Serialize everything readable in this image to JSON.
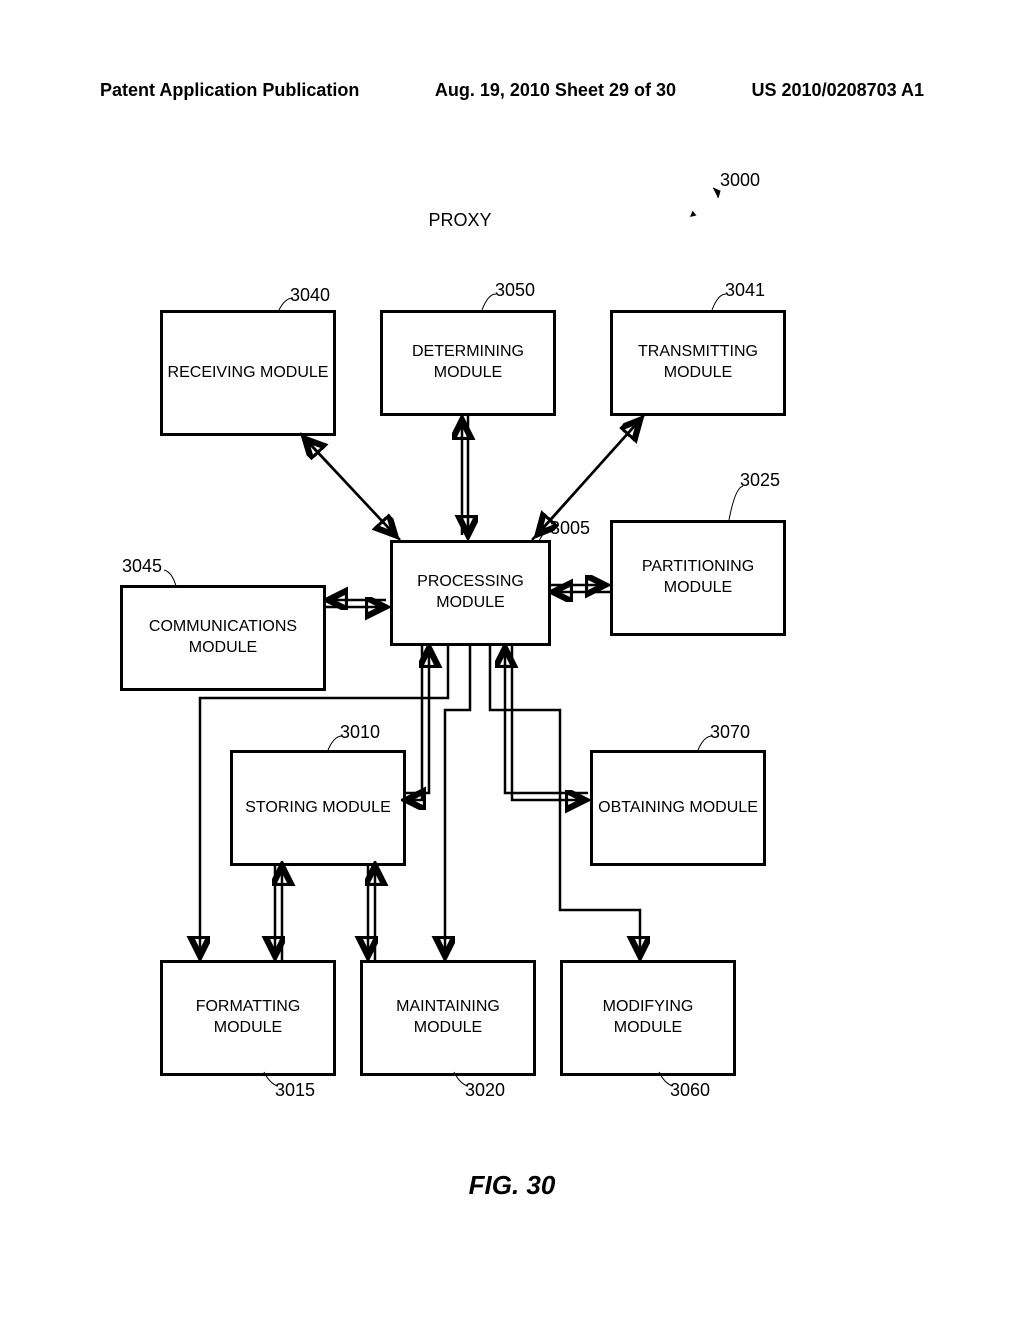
{
  "header": {
    "left": "Patent Application Publication",
    "center": "Aug. 19, 2010  Sheet 29 of 30",
    "right": "US 2010/0208703 A1"
  },
  "diagram": {
    "title": "PROXY",
    "systemRef": "3000",
    "boxes": {
      "receiving": {
        "label": "RECEIVING MODULE",
        "ref": "3040"
      },
      "determining": {
        "label": "DETERMINING MODULE",
        "ref": "3050"
      },
      "transmitting": {
        "label": "TRANSMITTING MODULE",
        "ref": "3041"
      },
      "processing": {
        "label": "PROCESSING MODULE",
        "ref": "3005"
      },
      "partitioning": {
        "label": "PARTITIONING MODULE",
        "ref": "3025"
      },
      "communications": {
        "label": "COMMUNICATIONS MODULE",
        "ref": "3045"
      },
      "storing": {
        "label": "STORING MODULE",
        "ref": "3010"
      },
      "obtaining": {
        "label": "OBTAINING MODULE",
        "ref": "3070"
      },
      "formatting": {
        "label": "FORMATTING MODULE",
        "ref": "3015"
      },
      "maintaining": {
        "label": "MAINTAINING MODULE",
        "ref": "3020"
      },
      "modifying": {
        "label": "MODIFYING MODULE",
        "ref": "3060"
      }
    }
  },
  "figure": "FIG. 30"
}
